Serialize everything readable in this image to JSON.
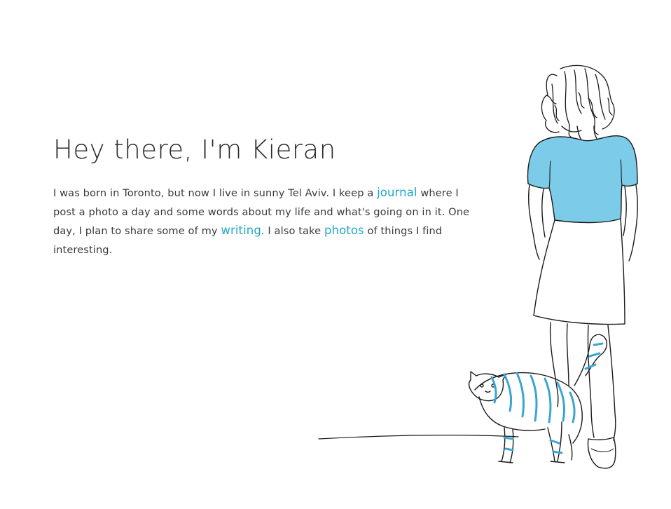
{
  "hero": {
    "title": "Hey there, I'm Kieran",
    "bio": {
      "part1": "I was born in Toronto, but now I live in sunny Tel Aviv. I keep a ",
      "link_journal": "journal",
      "part2": " where I post a photo a day and some words about my life and what's going on in it. One day, I plan to share some of my ",
      "link_writing": "writing",
      "part3": ". I also take ",
      "link_photos": "photos",
      "part4": " of things I find interesting."
    }
  },
  "illustration": {
    "subject": "person-and-cat-sketch-icon",
    "shirt_color": "#7ccbe8",
    "stripe_color": "#3aa6d0",
    "line_color": "#1a1a1a"
  },
  "colors": {
    "link": "#1fa8c9",
    "text": "#3a3a3a"
  }
}
